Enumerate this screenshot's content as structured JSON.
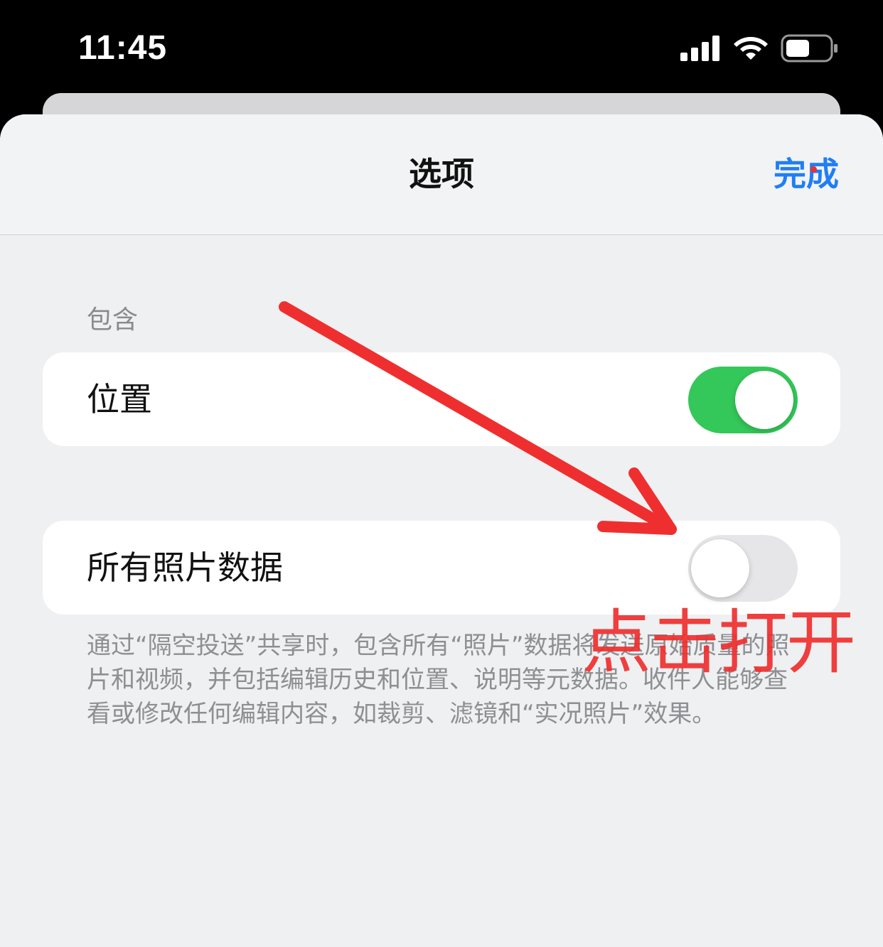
{
  "status_bar": {
    "time": "11:45",
    "signal_icon": "cellular-signal-icon",
    "wifi_icon": "wifi-icon",
    "battery_icon": "battery-icon"
  },
  "nav": {
    "title": "选项",
    "done_label": "完成",
    "accent_color": "#1f7ef6"
  },
  "section": {
    "header": "包含"
  },
  "rows": [
    {
      "label": "位置",
      "toggle_on": true
    },
    {
      "label": "所有照片数据",
      "toggle_on": false
    }
  ],
  "footer": {
    "text": "通过“隔空投送”共享时，包含所有“照片”数据将发送原始质量的照片和视频，并包括编辑历史和位置、说明等元数据。收件人能够查看或修改任何编辑内容，如裁剪、滤镜和“实况照片”效果。"
  },
  "annotation": {
    "text": "点击打开",
    "color": "#ef2f2f"
  },
  "colors": {
    "toggle_on": "#34c759",
    "toggle_off": "#e6e6e8",
    "sheet_background": "#eff0f1"
  }
}
